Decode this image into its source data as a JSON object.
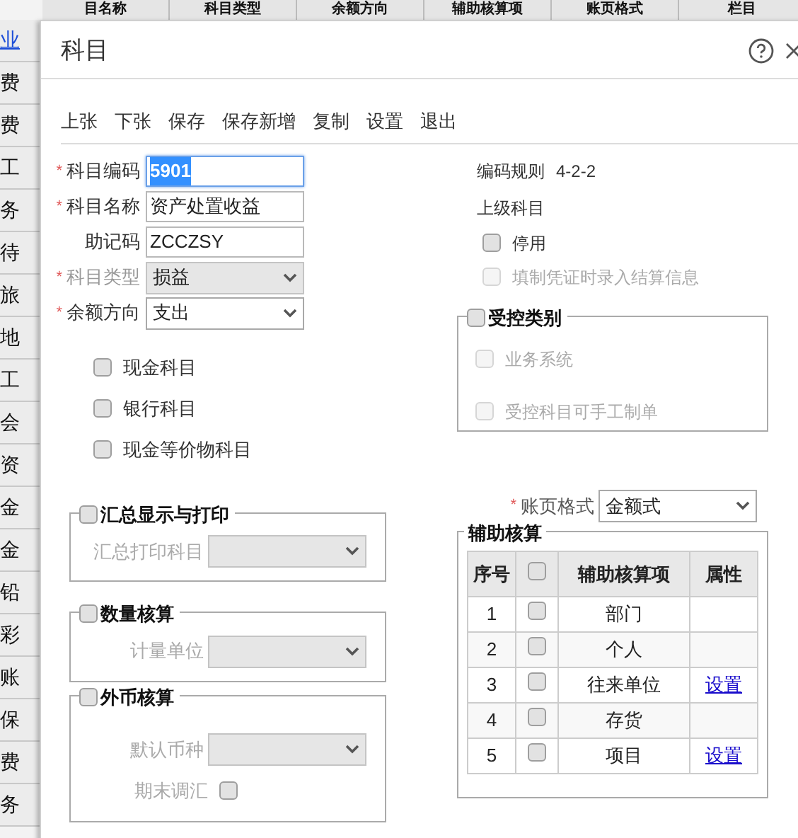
{
  "background_sheet": {
    "header": [
      "目名称",
      "科目类型",
      "余额方向",
      "辅助核算项",
      "账页格式",
      "栏目"
    ],
    "column_cells": [
      "业",
      "费",
      "费",
      "工",
      "务",
      "待",
      "旅",
      "地",
      "工",
      "会",
      "资",
      "金",
      "金",
      "铅",
      "彩",
      "账",
      "保",
      "费",
      "务"
    ]
  },
  "dialog": {
    "title": "科目"
  },
  "toolbar": [
    "上张",
    "下张",
    "保存",
    "保存新增",
    "复制",
    "设置",
    "退出"
  ],
  "fields": [
    {
      "kind": "text",
      "required_mark": "*",
      "label": "科目编码",
      "disabled": false,
      "value": "5901",
      "focused": true
    },
    {
      "kind": "text",
      "required_mark": "*",
      "label": "科目名称",
      "disabled": false,
      "value": "资产处置收益",
      "focused": false
    },
    {
      "kind": "text",
      "label": "助记码",
      "disabled": false,
      "value": "ZCCZSY",
      "focused": false
    },
    {
      "kind": "select",
      "required_mark": "*",
      "label": "科目类型",
      "disabled": true,
      "value": "损益",
      "focused": false
    },
    {
      "kind": "select",
      "required_mark": "*",
      "label": "余额方向",
      "disabled": false,
      "value": "支出",
      "focused": false
    }
  ],
  "left_checks": [
    {
      "label": "现金科目",
      "checked": false
    },
    {
      "label": "银行科目",
      "checked": false
    },
    {
      "label": "现金等价物科目",
      "checked": false
    }
  ],
  "info": [
    {
      "label": "编码规则",
      "value": "4-2-2"
    },
    {
      "label": "上级科目"
    }
  ],
  "right_checks": [
    {
      "label": "停用",
      "checked": false,
      "disabled": false
    },
    {
      "label": "填制凭证时录入结算信息",
      "checked": false,
      "disabled": true
    }
  ],
  "controlled": {
    "title": "受控类别",
    "checked": false,
    "items": [
      {
        "label": "业务系统",
        "checked": false,
        "disabled": true
      },
      {
        "label": "受控科目可手工制单",
        "checked": false,
        "disabled": true
      }
    ]
  },
  "summary": {
    "title": "汇总显示与打印",
    "checked": false,
    "field_label": "汇总打印科目"
  },
  "quantity": {
    "title": "数量核算",
    "checked": false,
    "field_label": "计量单位"
  },
  "currency": {
    "title": "外币核算",
    "checked": false,
    "field_label": "默认币种",
    "check_label": "期末调汇",
    "check_checked": false
  },
  "ledger_format": {
    "required_mark": "*",
    "label": "账页格式",
    "value": "金额式"
  },
  "aux": {
    "title": "辅助核算",
    "columns": [
      "序号",
      "辅助核算项",
      "属性"
    ],
    "header_checked": false,
    "rows": [
      {
        "no": "1",
        "checked": false,
        "item": "部门"
      },
      {
        "no": "2",
        "checked": false,
        "item": "个人"
      },
      {
        "no": "3",
        "checked": false,
        "item": "往来单位",
        "link": "设置"
      },
      {
        "no": "4",
        "checked": false,
        "item": "存货"
      },
      {
        "no": "5",
        "checked": false,
        "item": "项目",
        "link": "设置"
      }
    ]
  }
}
